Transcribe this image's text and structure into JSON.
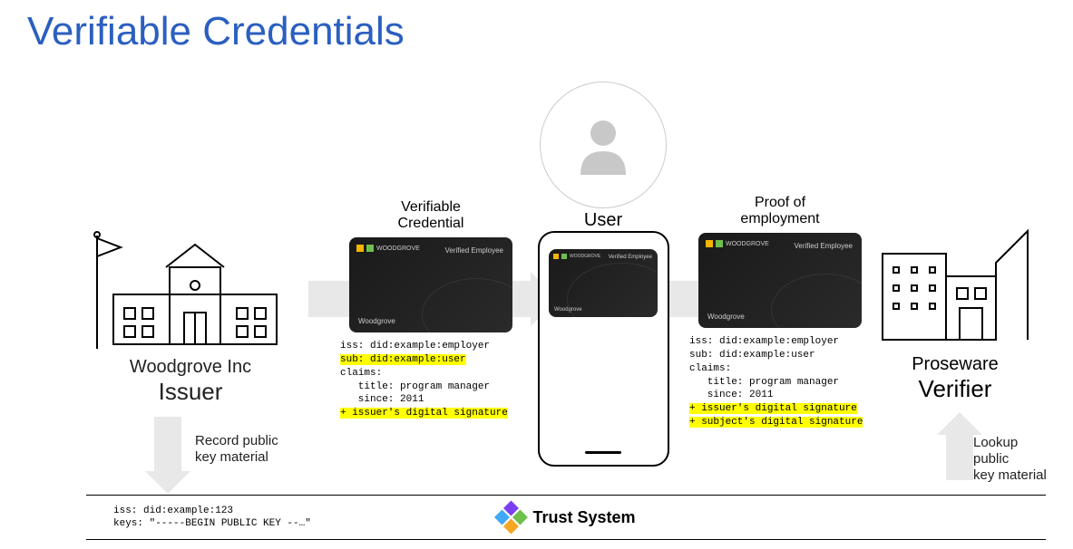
{
  "title": "Verifiable Credentials",
  "issuer": {
    "name": "Woodgrove Inc",
    "role": "Issuer"
  },
  "verifiable_credential_label": "Verifiable\nCredential",
  "card": {
    "logo_text": "WOODGROVE",
    "tag": "Verified Employee",
    "brand": "Woodgrove"
  },
  "vc_code": {
    "line1": "iss: did:example:employer",
    "line2": "sub: did:example:user",
    "line3": "claims:",
    "line4": "   title: program manager",
    "line5": "   since: 2011",
    "line6": "+ issuer's digital signature"
  },
  "user_label": "User",
  "proof_label": "Proof of\nemployment",
  "proof_code": {
    "line1": "iss: did:example:employer",
    "line2": "sub: did:example:user",
    "line3": "claims:",
    "line4": "   title: program manager",
    "line5": "   since: 2011",
    "line6": "+ issuer's digital signature",
    "line7": "+ subject's digital signature"
  },
  "verifier": {
    "name": "Proseware",
    "role": "Verifier"
  },
  "record_label": "Record public\nkey material",
  "lookup_label": "Lookup public\nkey material",
  "trust": {
    "keys_line1": "iss: did:example:123",
    "keys_line2": "keys: \"-----BEGIN PUBLIC KEY --…\"",
    "title": "Trust System"
  }
}
